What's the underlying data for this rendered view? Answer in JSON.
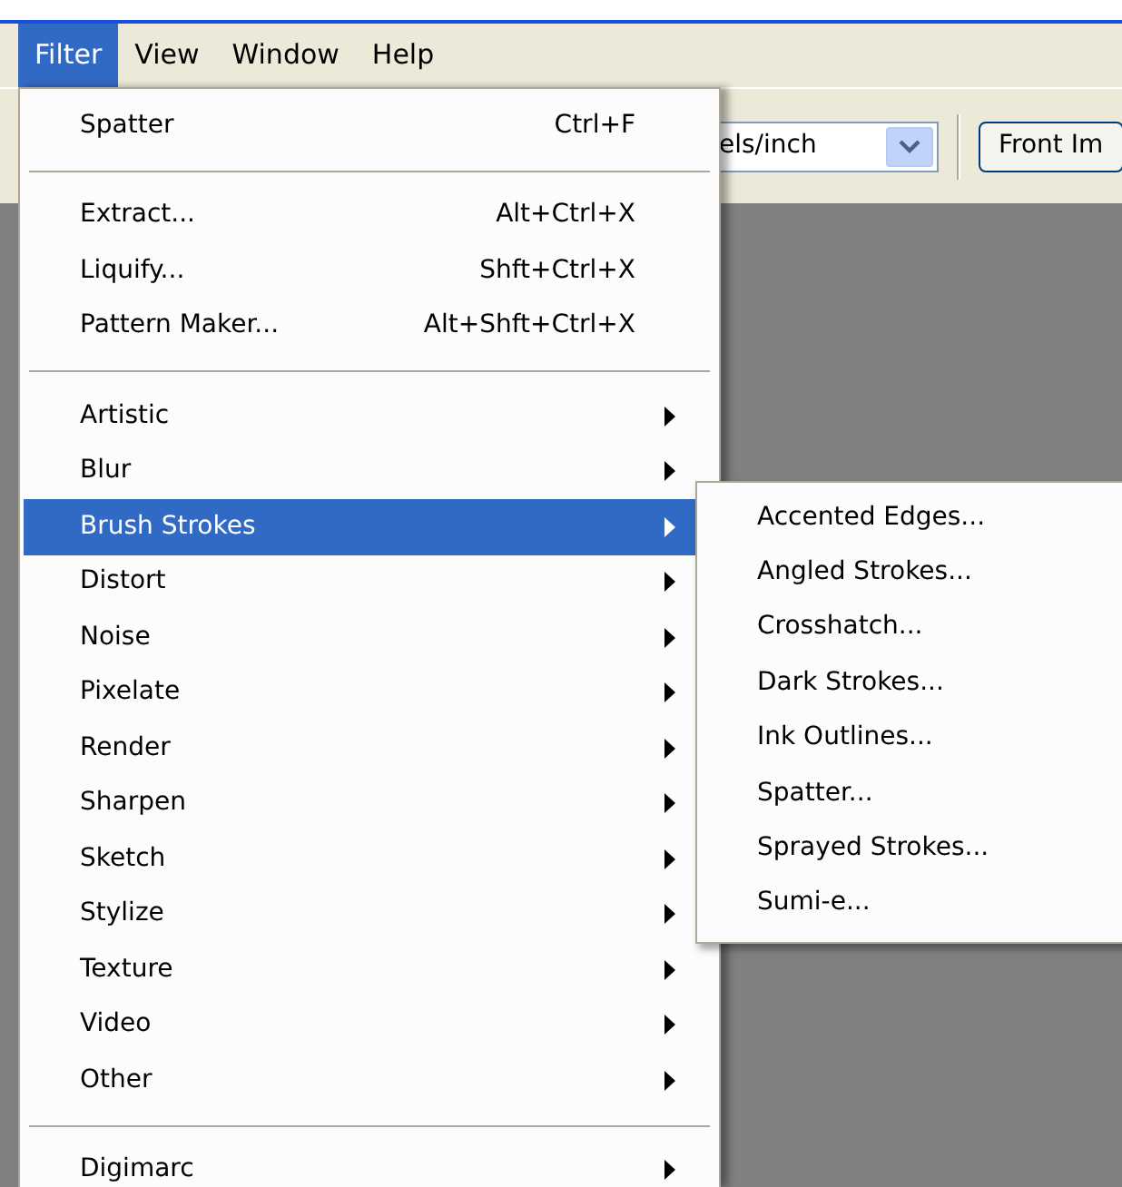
{
  "menubar": [
    {
      "label": "Filter",
      "selected": true
    },
    {
      "label": "View",
      "selected": false
    },
    {
      "label": "Window",
      "selected": false
    },
    {
      "label": "Help",
      "selected": false
    }
  ],
  "toolbar": {
    "units_field": "els/inch",
    "button": "Front Im"
  },
  "menu": {
    "items": [
      {
        "kind": "item",
        "label": "Spatter",
        "shortcut": "Ctrl+F",
        "selected": false
      },
      {
        "kind": "separator"
      },
      {
        "kind": "item",
        "label": "Extract...",
        "shortcut": "Alt+Ctrl+X",
        "selected": false
      },
      {
        "kind": "item",
        "label": "Liquify...",
        "shortcut": "Shft+Ctrl+X",
        "selected": false
      },
      {
        "kind": "item",
        "label": "Pattern Maker...",
        "shortcut": "Alt+Shft+Ctrl+X",
        "selected": false
      },
      {
        "kind": "separator"
      },
      {
        "kind": "submenu",
        "label": "Artistic",
        "selected": false
      },
      {
        "kind": "submenu",
        "label": "Blur",
        "selected": false
      },
      {
        "kind": "submenu",
        "label": "Brush Strokes",
        "selected": true
      },
      {
        "kind": "submenu",
        "label": "Distort",
        "selected": false
      },
      {
        "kind": "submenu",
        "label": "Noise",
        "selected": false
      },
      {
        "kind": "submenu",
        "label": "Pixelate",
        "selected": false
      },
      {
        "kind": "submenu",
        "label": "Render",
        "selected": false
      },
      {
        "kind": "submenu",
        "label": "Sharpen",
        "selected": false
      },
      {
        "kind": "submenu",
        "label": "Sketch",
        "selected": false
      },
      {
        "kind": "submenu",
        "label": "Stylize",
        "selected": false
      },
      {
        "kind": "submenu",
        "label": "Texture",
        "selected": false
      },
      {
        "kind": "submenu",
        "label": "Video",
        "selected": false
      },
      {
        "kind": "submenu",
        "label": "Other",
        "selected": false
      },
      {
        "kind": "separator"
      },
      {
        "kind": "submenu",
        "label": "Digimarc",
        "selected": false
      }
    ]
  },
  "submenu": {
    "items": [
      {
        "label": "Accented Edges...",
        "selected": false
      },
      {
        "label": "Angled Strokes...",
        "selected": false
      },
      {
        "label": "Crosshatch...",
        "selected": false
      },
      {
        "label": "Dark Strokes...",
        "selected": false
      },
      {
        "label": "Ink Outlines...",
        "selected": false
      },
      {
        "label": "Spatter...",
        "selected": false
      },
      {
        "label": "Sprayed Strokes...",
        "selected": false
      },
      {
        "label": "Sumi-e...",
        "selected": false
      }
    ]
  }
}
